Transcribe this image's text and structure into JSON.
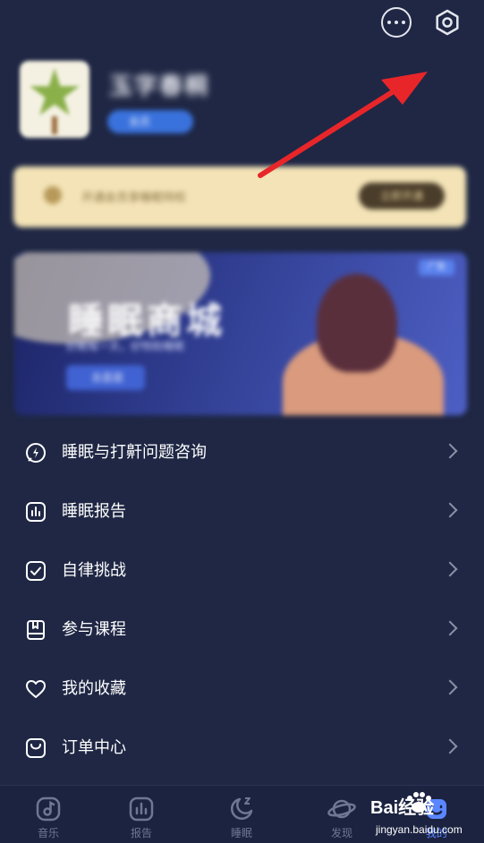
{
  "header": {
    "more_icon": "more-dots-icon",
    "settings_icon": "settings-hexagon-icon"
  },
  "profile": {
    "username": "玉字春桐",
    "badge": "会员"
  },
  "member_banner": {
    "text": "开通会员享睡眠特权",
    "button_label": "立即开通"
  },
  "promo_banner": {
    "title": "睡眠商城",
    "subtitle": "好眠每一天，好物助睡眠",
    "pill_label": "去逛逛",
    "tag": "广告"
  },
  "menu": {
    "items": [
      {
        "label": "睡眠与打鼾问题咨询",
        "icon": "consult-chat-icon"
      },
      {
        "label": "睡眠报告",
        "icon": "report-chart-icon"
      },
      {
        "label": "自律挑战",
        "icon": "challenge-check-icon"
      },
      {
        "label": "参与课程",
        "icon": "course-book-icon"
      },
      {
        "label": "我的收藏",
        "icon": "heart-icon"
      },
      {
        "label": "订单中心",
        "icon": "order-bag-icon"
      }
    ]
  },
  "tabbar": {
    "tabs": [
      {
        "label": "音乐",
        "icon": "music-icon"
      },
      {
        "label": "报告",
        "icon": "report-icon"
      },
      {
        "label": "睡眠",
        "icon": "moon-icon"
      },
      {
        "label": "发现",
        "icon": "planet-icon"
      },
      {
        "label": "我的",
        "icon": "profile-icon",
        "active": true
      }
    ]
  },
  "watermark": {
    "line1": "Bai经验",
    "line2": "jingyan.baidu.com"
  },
  "colors": {
    "background": "#1f2744",
    "accent": "#5a86ff",
    "annotation_arrow": "#e8262a"
  }
}
